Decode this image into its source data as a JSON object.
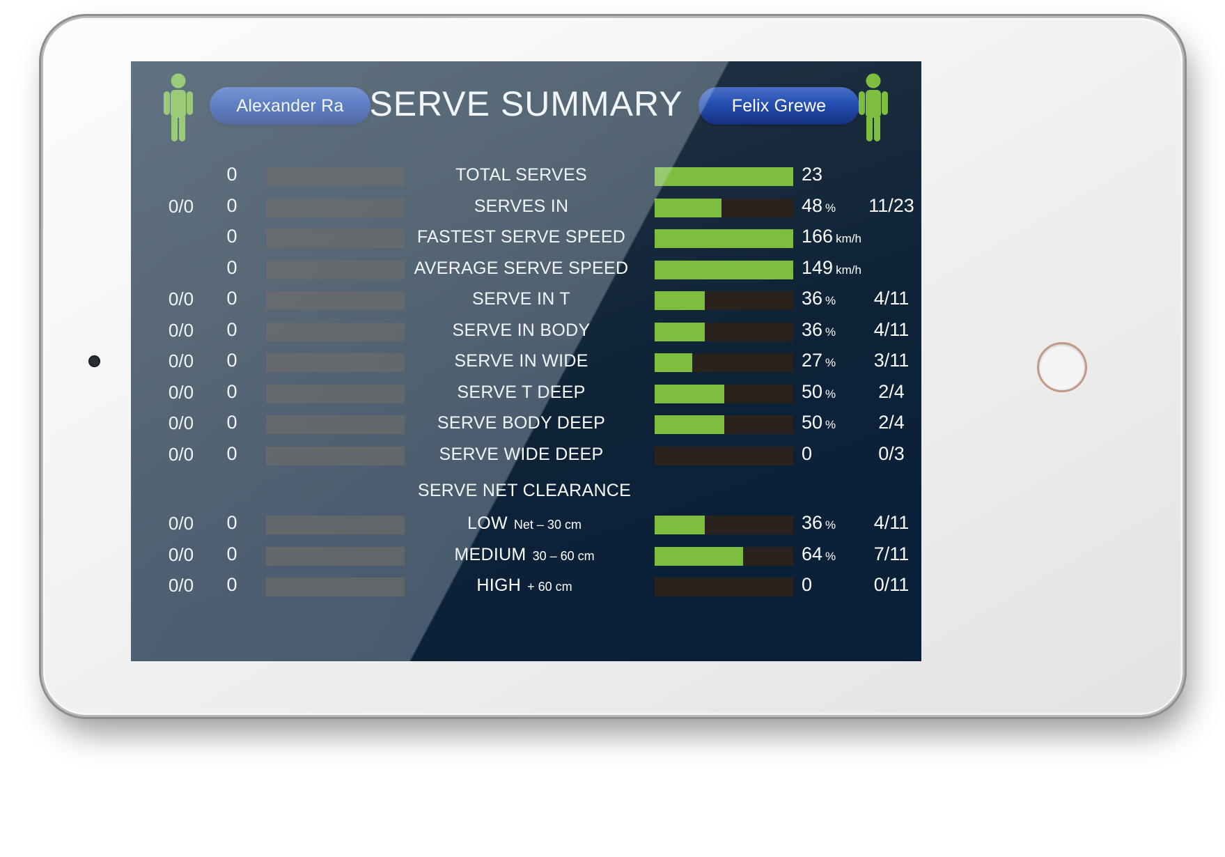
{
  "header": {
    "title": "SERVE SUMMARY",
    "player_left": "Alexander Ra",
    "player_right": "Felix Grewe",
    "icon_left": "person-icon",
    "icon_right": "person-icon"
  },
  "colors": {
    "bar_fill": "#7dbe3e",
    "bar_track": "#2a221c",
    "pill": "#2550b4",
    "screen_bg": "#0d2237",
    "text": "#ffffff"
  },
  "chart_data": {
    "type": "bar",
    "title": "SERVE SUMMARY",
    "legend": [
      "Alexander Ra",
      "Felix Grewe"
    ],
    "categories": [
      "TOTAL SERVES",
      "SERVES IN",
      "FASTEST SERVE SPEED",
      "AVERAGE SERVE SPEED",
      "SERVE IN T",
      "SERVE IN BODY",
      "SERVE IN WIDE",
      "SERVE T DEEP",
      "SERVE BODY DEEP",
      "SERVE WIDE DEEP",
      "LOW",
      "MEDIUM",
      "HIGH"
    ],
    "series": [
      {
        "name": "Alexander Ra",
        "values": [
          0,
          0,
          0,
          0,
          0,
          0,
          0,
          0,
          0,
          0,
          0,
          0,
          0
        ]
      },
      {
        "name": "Felix Grewe",
        "values": [
          23,
          48,
          166,
          149,
          36,
          36,
          27,
          50,
          50,
          0,
          36,
          64,
          0
        ]
      }
    ]
  },
  "sections": [
    {
      "rows": [
        {
          "label": "TOTAL SERVES",
          "sub": "",
          "left_frac": "",
          "left_value": "0",
          "left_pct": 0,
          "right_value": "23",
          "right_unit": "",
          "right_frac": "",
          "right_pct": 100
        },
        {
          "label": "SERVES IN",
          "sub": "",
          "left_frac": "0/0",
          "left_value": "0",
          "left_pct": 0,
          "right_value": "48",
          "right_unit": "%",
          "right_frac": "11/23",
          "right_pct": 48
        },
        {
          "label": "FASTEST SERVE SPEED",
          "sub": "",
          "left_frac": "",
          "left_value": "0",
          "left_pct": 0,
          "right_value": "166",
          "right_unit": "km/h",
          "right_frac": "",
          "right_pct": 100
        },
        {
          "label": "AVERAGE SERVE SPEED",
          "sub": "",
          "left_frac": "",
          "left_value": "0",
          "left_pct": 0,
          "right_value": "149",
          "right_unit": "km/h",
          "right_frac": "",
          "right_pct": 100
        },
        {
          "label": "SERVE IN T",
          "sub": "",
          "left_frac": "0/0",
          "left_value": "0",
          "left_pct": 0,
          "right_value": "36",
          "right_unit": "%",
          "right_frac": "4/11",
          "right_pct": 36
        },
        {
          "label": "SERVE IN BODY",
          "sub": "",
          "left_frac": "0/0",
          "left_value": "0",
          "left_pct": 0,
          "right_value": "36",
          "right_unit": "%",
          "right_frac": "4/11",
          "right_pct": 36
        },
        {
          "label": "SERVE IN WIDE",
          "sub": "",
          "left_frac": "0/0",
          "left_value": "0",
          "left_pct": 0,
          "right_value": "27",
          "right_unit": "%",
          "right_frac": "3/11",
          "right_pct": 27
        },
        {
          "label": "SERVE T DEEP",
          "sub": "",
          "left_frac": "0/0",
          "left_value": "0",
          "left_pct": 0,
          "right_value": "50",
          "right_unit": "%",
          "right_frac": "2/4",
          "right_pct": 50
        },
        {
          "label": "SERVE BODY DEEP",
          "sub": "",
          "left_frac": "0/0",
          "left_value": "0",
          "left_pct": 0,
          "right_value": "50",
          "right_unit": "%",
          "right_frac": "2/4",
          "right_pct": 50
        },
        {
          "label": "SERVE WIDE DEEP",
          "sub": "",
          "left_frac": "0/0",
          "left_value": "0",
          "left_pct": 0,
          "right_value": "0",
          "right_unit": "",
          "right_frac": "0/3",
          "right_pct": 0
        }
      ]
    },
    {
      "title": "SERVE NET CLEARANCE",
      "rows": [
        {
          "label": "LOW",
          "sub": "Net – 30 cm",
          "left_frac": "0/0",
          "left_value": "0",
          "left_pct": 0,
          "right_value": "36",
          "right_unit": "%",
          "right_frac": "4/11",
          "right_pct": 36
        },
        {
          "label": "MEDIUM",
          "sub": "30 – 60 cm",
          "left_frac": "0/0",
          "left_value": "0",
          "left_pct": 0,
          "right_value": "64",
          "right_unit": "%",
          "right_frac": "7/11",
          "right_pct": 64
        },
        {
          "label": "HIGH",
          "sub": "+ 60 cm",
          "left_frac": "0/0",
          "left_value": "0",
          "left_pct": 0,
          "right_value": "0",
          "right_unit": "",
          "right_frac": "0/11",
          "right_pct": 0
        }
      ]
    }
  ]
}
